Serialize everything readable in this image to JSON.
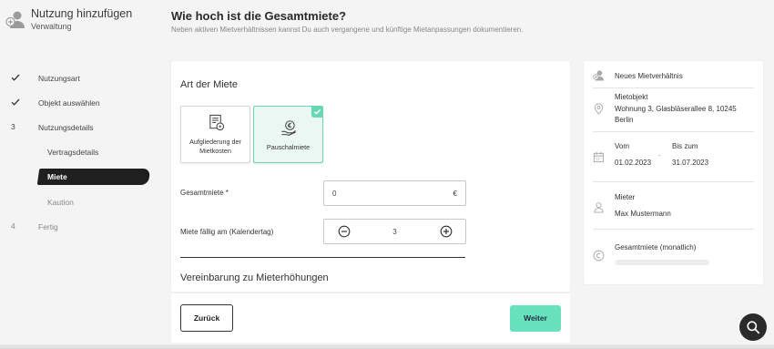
{
  "app": {
    "title": "Nutzung hinzufügen",
    "subtitle": "Verwaltung",
    "logo_icon": "person-add-icon"
  },
  "page": {
    "title": "Wie hoch ist die Gesamtmiete?",
    "subtitle": "Neben aktiven Mietverhältnissen kannst Du auch vergangene und künftige Mietanpassungen dokumentieren."
  },
  "steps": [
    {
      "mark": "check-icon",
      "label": "Nutzungsart"
    },
    {
      "mark": "check-icon",
      "label": "Objekt auswählen"
    },
    {
      "number": "3",
      "label": "Nutzungsdetails"
    },
    {
      "label": "Vertragsdetails"
    },
    {
      "label": "Miete",
      "active": true
    },
    {
      "label": "Kaution"
    },
    {
      "number": "4",
      "label": "Fertig"
    }
  ],
  "form": {
    "section_title": "Art der Miete",
    "options": [
      {
        "label": "Aufgliederung der Mietkosten",
        "icon": "itemized-invoice-icon",
        "selected": false
      },
      {
        "label": "Pauschalmiete",
        "icon": "hand-coin-icon",
        "selected": true
      }
    ],
    "total_rent_label": "Gesamtmiete *",
    "total_rent_value": "0",
    "currency": "€",
    "due_day_label": "Miete fällig am (Kalendertag)",
    "due_day_value": "3",
    "next_section_title": "Vereinbarung zu Mieterhöhungen"
  },
  "footer": {
    "back_label": "Zurück",
    "next_label": "Weiter"
  },
  "summary": {
    "header": "Neues Mietverhältnis",
    "object_label": "Mietobjekt",
    "object_value": "Wohnung 3, Glasbläserallee 8, 10245 Berlin",
    "from_label": "Vom",
    "from_value": "01.02.2023",
    "separator": "-",
    "to_label": "Bis zum",
    "to_value": "31.07.2023",
    "tenant_label": "Mieter",
    "tenant_value": "Max Mustermann",
    "rent_label": "Gesamtmiete (monatlich)"
  },
  "colors": {
    "accent": "#68e2bd",
    "selected_bg": "#eaf7f2",
    "dark": "#1f1f1f"
  }
}
